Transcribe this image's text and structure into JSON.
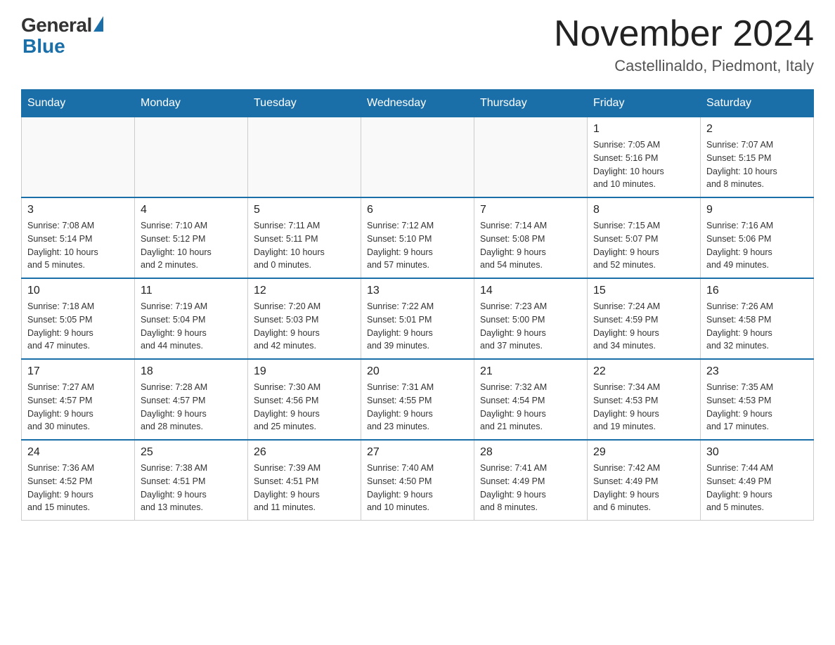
{
  "header": {
    "logo_general": "General",
    "logo_blue": "Blue",
    "month_title": "November 2024",
    "location": "Castellinaldo, Piedmont, Italy"
  },
  "days_of_week": [
    "Sunday",
    "Monday",
    "Tuesday",
    "Wednesday",
    "Thursday",
    "Friday",
    "Saturday"
  ],
  "weeks": [
    {
      "days": [
        {
          "number": "",
          "info": ""
        },
        {
          "number": "",
          "info": ""
        },
        {
          "number": "",
          "info": ""
        },
        {
          "number": "",
          "info": ""
        },
        {
          "number": "",
          "info": ""
        },
        {
          "number": "1",
          "info": "Sunrise: 7:05 AM\nSunset: 5:16 PM\nDaylight: 10 hours\nand 10 minutes."
        },
        {
          "number": "2",
          "info": "Sunrise: 7:07 AM\nSunset: 5:15 PM\nDaylight: 10 hours\nand 8 minutes."
        }
      ]
    },
    {
      "days": [
        {
          "number": "3",
          "info": "Sunrise: 7:08 AM\nSunset: 5:14 PM\nDaylight: 10 hours\nand 5 minutes."
        },
        {
          "number": "4",
          "info": "Sunrise: 7:10 AM\nSunset: 5:12 PM\nDaylight: 10 hours\nand 2 minutes."
        },
        {
          "number": "5",
          "info": "Sunrise: 7:11 AM\nSunset: 5:11 PM\nDaylight: 10 hours\nand 0 minutes."
        },
        {
          "number": "6",
          "info": "Sunrise: 7:12 AM\nSunset: 5:10 PM\nDaylight: 9 hours\nand 57 minutes."
        },
        {
          "number": "7",
          "info": "Sunrise: 7:14 AM\nSunset: 5:08 PM\nDaylight: 9 hours\nand 54 minutes."
        },
        {
          "number": "8",
          "info": "Sunrise: 7:15 AM\nSunset: 5:07 PM\nDaylight: 9 hours\nand 52 minutes."
        },
        {
          "number": "9",
          "info": "Sunrise: 7:16 AM\nSunset: 5:06 PM\nDaylight: 9 hours\nand 49 minutes."
        }
      ]
    },
    {
      "days": [
        {
          "number": "10",
          "info": "Sunrise: 7:18 AM\nSunset: 5:05 PM\nDaylight: 9 hours\nand 47 minutes."
        },
        {
          "number": "11",
          "info": "Sunrise: 7:19 AM\nSunset: 5:04 PM\nDaylight: 9 hours\nand 44 minutes."
        },
        {
          "number": "12",
          "info": "Sunrise: 7:20 AM\nSunset: 5:03 PM\nDaylight: 9 hours\nand 42 minutes."
        },
        {
          "number": "13",
          "info": "Sunrise: 7:22 AM\nSunset: 5:01 PM\nDaylight: 9 hours\nand 39 minutes."
        },
        {
          "number": "14",
          "info": "Sunrise: 7:23 AM\nSunset: 5:00 PM\nDaylight: 9 hours\nand 37 minutes."
        },
        {
          "number": "15",
          "info": "Sunrise: 7:24 AM\nSunset: 4:59 PM\nDaylight: 9 hours\nand 34 minutes."
        },
        {
          "number": "16",
          "info": "Sunrise: 7:26 AM\nSunset: 4:58 PM\nDaylight: 9 hours\nand 32 minutes."
        }
      ]
    },
    {
      "days": [
        {
          "number": "17",
          "info": "Sunrise: 7:27 AM\nSunset: 4:57 PM\nDaylight: 9 hours\nand 30 minutes."
        },
        {
          "number": "18",
          "info": "Sunrise: 7:28 AM\nSunset: 4:57 PM\nDaylight: 9 hours\nand 28 minutes."
        },
        {
          "number": "19",
          "info": "Sunrise: 7:30 AM\nSunset: 4:56 PM\nDaylight: 9 hours\nand 25 minutes."
        },
        {
          "number": "20",
          "info": "Sunrise: 7:31 AM\nSunset: 4:55 PM\nDaylight: 9 hours\nand 23 minutes."
        },
        {
          "number": "21",
          "info": "Sunrise: 7:32 AM\nSunset: 4:54 PM\nDaylight: 9 hours\nand 21 minutes."
        },
        {
          "number": "22",
          "info": "Sunrise: 7:34 AM\nSunset: 4:53 PM\nDaylight: 9 hours\nand 19 minutes."
        },
        {
          "number": "23",
          "info": "Sunrise: 7:35 AM\nSunset: 4:53 PM\nDaylight: 9 hours\nand 17 minutes."
        }
      ]
    },
    {
      "days": [
        {
          "number": "24",
          "info": "Sunrise: 7:36 AM\nSunset: 4:52 PM\nDaylight: 9 hours\nand 15 minutes."
        },
        {
          "number": "25",
          "info": "Sunrise: 7:38 AM\nSunset: 4:51 PM\nDaylight: 9 hours\nand 13 minutes."
        },
        {
          "number": "26",
          "info": "Sunrise: 7:39 AM\nSunset: 4:51 PM\nDaylight: 9 hours\nand 11 minutes."
        },
        {
          "number": "27",
          "info": "Sunrise: 7:40 AM\nSunset: 4:50 PM\nDaylight: 9 hours\nand 10 minutes."
        },
        {
          "number": "28",
          "info": "Sunrise: 7:41 AM\nSunset: 4:49 PM\nDaylight: 9 hours\nand 8 minutes."
        },
        {
          "number": "29",
          "info": "Sunrise: 7:42 AM\nSunset: 4:49 PM\nDaylight: 9 hours\nand 6 minutes."
        },
        {
          "number": "30",
          "info": "Sunrise: 7:44 AM\nSunset: 4:49 PM\nDaylight: 9 hours\nand 5 minutes."
        }
      ]
    }
  ]
}
